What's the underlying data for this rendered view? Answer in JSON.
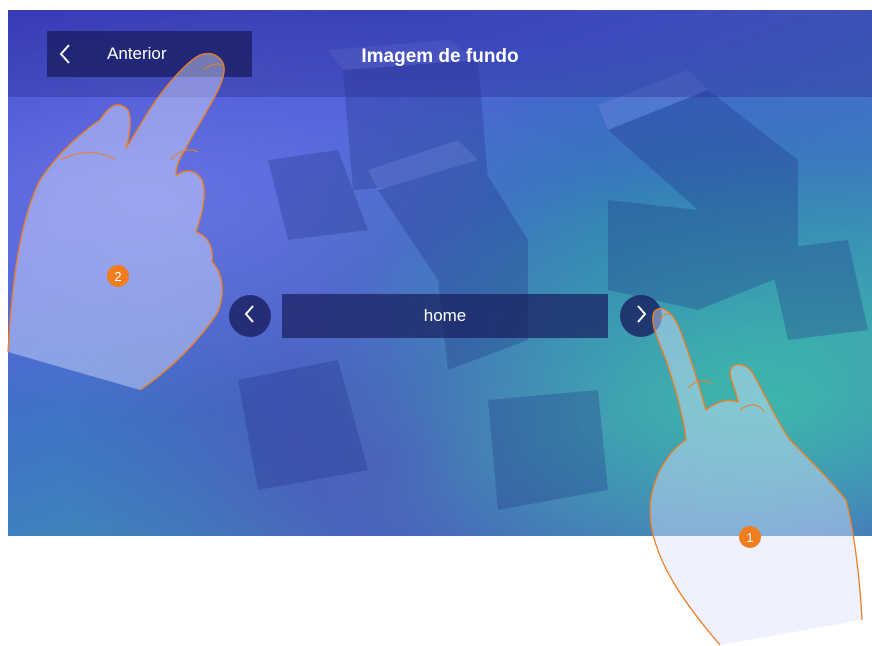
{
  "header": {
    "back_label": "Anterior",
    "title": "Imagem de fundo"
  },
  "selector": {
    "value": "home"
  },
  "icons": {
    "back": "chevron-left-icon",
    "prev": "chevron-left-icon",
    "next": "chevron-right-icon",
    "hand": "pointing-hand-icon"
  },
  "steps": {
    "first": "1",
    "second": "2"
  },
  "colors": {
    "step_badge": "#f07e1e",
    "hand_outline": "#f07e1e",
    "bar_background": "#191e64"
  }
}
